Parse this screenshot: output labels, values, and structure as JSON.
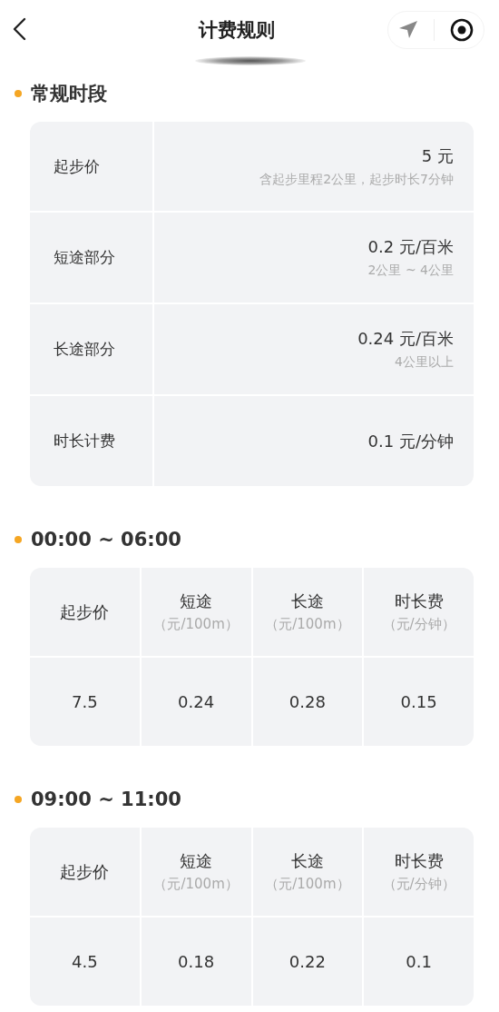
{
  "header": {
    "title": "计费规则"
  },
  "regular": {
    "title": "常规时段",
    "rows": [
      {
        "label": "起步价",
        "value": "5 元",
        "note": "含起步里程2公里，起步时长7分钟"
      },
      {
        "label": "短途部分",
        "value": "0.2 元/百米",
        "note": "2公里 ~ 4公里"
      },
      {
        "label": "长途部分",
        "value": "0.24 元/百米",
        "note": "4公里以上"
      },
      {
        "label": "时长计费",
        "value": "0.1 元/分钟"
      }
    ]
  },
  "periods": [
    {
      "title": "00:00 ~ 06:00",
      "columns": [
        {
          "label": "起步价"
        },
        {
          "label": "短途",
          "unit": "（元/100m）"
        },
        {
          "label": "长途",
          "unit": "（元/100m）"
        },
        {
          "label": "时长费",
          "unit": "（元/分钟）"
        }
      ],
      "values": [
        "7.5",
        "0.24",
        "0.28",
        "0.15"
      ]
    },
    {
      "title": "09:00 ~ 11:00",
      "columns": [
        {
          "label": "起步价"
        },
        {
          "label": "短途",
          "unit": "（元/100m）"
        },
        {
          "label": "长途",
          "unit": "（元/100m）"
        },
        {
          "label": "时长费",
          "unit": "（元/分钟）"
        }
      ],
      "values": [
        "4.5",
        "0.18",
        "0.22",
        "0.1"
      ]
    }
  ]
}
